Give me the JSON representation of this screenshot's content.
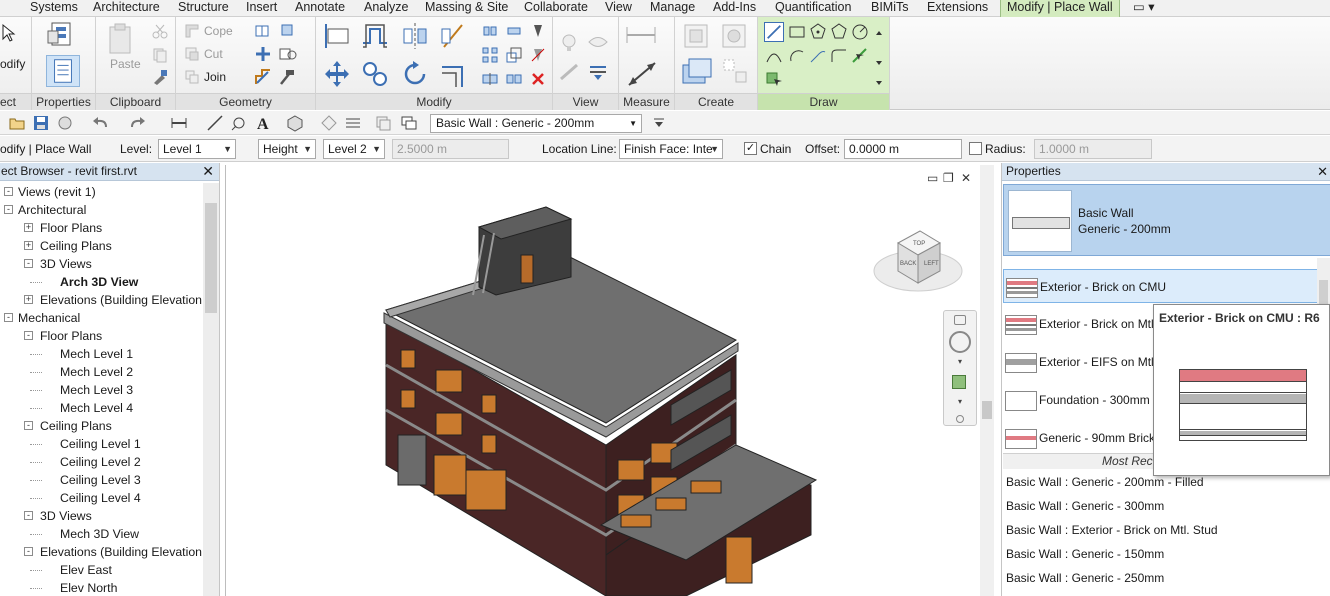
{
  "ribbon_tabs": [
    "Systems",
    "Architecture",
    "Structure",
    "Insert",
    "Annotate",
    "Analyze",
    "Massing & Site",
    "Collaborate",
    "View",
    "Manage",
    "Add-Ins",
    "Quantification",
    "BIMiTs",
    "Extensions",
    "Modify | Place Wall"
  ],
  "active_tab": "Modify | Place Wall",
  "ribbon": {
    "select_label": "ect",
    "modify_label": "odify",
    "panels": {
      "properties": "Properties",
      "clipboard": "Clipboard",
      "geometry": "Geometry",
      "modify": "Modify",
      "view": "View",
      "measure": "Measure",
      "create": "Create",
      "draw": "Draw"
    },
    "clipboard": {
      "paste": "Paste"
    },
    "geometry": {
      "cope": "Cope",
      "cut": "Cut",
      "join": "Join"
    }
  },
  "qat": {
    "type_selector": "Basic Wall : Generic - 200mm"
  },
  "options_bar": {
    "context": "odify | Place Wall",
    "level_label": "Level:",
    "level_value": "Level 1",
    "height_mode": "Height",
    "height_target": "Level 2",
    "height_value": "2.5000 m",
    "location_line_label": "Location Line:",
    "location_line_value": "Finish Face: Inte",
    "chain_label": "Chain",
    "chain_checked": true,
    "offset_label": "Offset:",
    "offset_value": "0.0000 m",
    "radius_label": "Radius:",
    "radius_checked": false,
    "radius_value": "1.0000 m"
  },
  "project_browser": {
    "title": "ect Browser - revit first.rvt",
    "tree": [
      {
        "label": "Views (revit 1)",
        "level": 0,
        "toggle": "-"
      },
      {
        "label": "Architectural",
        "level": 0,
        "toggle": "-"
      },
      {
        "label": "Floor Plans",
        "level": 1,
        "toggle": "+"
      },
      {
        "label": "Ceiling Plans",
        "level": 1,
        "toggle": "+"
      },
      {
        "label": "3D Views",
        "level": 1,
        "toggle": "-"
      },
      {
        "label": "Arch 3D View",
        "level": 2,
        "toggle": "",
        "bold": true
      },
      {
        "label": "Elevations (Building Elevation",
        "level": 1,
        "toggle": "+"
      },
      {
        "label": "Mechanical",
        "level": 0,
        "toggle": "-"
      },
      {
        "label": "Floor Plans",
        "level": 1,
        "toggle": "-"
      },
      {
        "label": "Mech Level 1",
        "level": 2,
        "toggle": ""
      },
      {
        "label": "Mech Level 2",
        "level": 2,
        "toggle": ""
      },
      {
        "label": "Mech Level 3",
        "level": 2,
        "toggle": ""
      },
      {
        "label": "Mech Level 4",
        "level": 2,
        "toggle": ""
      },
      {
        "label": "Ceiling Plans",
        "level": 1,
        "toggle": "-"
      },
      {
        "label": "Ceiling Level 1",
        "level": 2,
        "toggle": ""
      },
      {
        "label": "Ceiling Level 2",
        "level": 2,
        "toggle": ""
      },
      {
        "label": "Ceiling Level 3",
        "level": 2,
        "toggle": ""
      },
      {
        "label": "Ceiling Level 4",
        "level": 2,
        "toggle": ""
      },
      {
        "label": "3D Views",
        "level": 1,
        "toggle": "-"
      },
      {
        "label": "Mech 3D View",
        "level": 2,
        "toggle": ""
      },
      {
        "label": "Elevations (Building Elevation",
        "level": 1,
        "toggle": "-"
      },
      {
        "label": "Elev East",
        "level": 2,
        "toggle": ""
      },
      {
        "label": "Elev North",
        "level": 2,
        "toggle": ""
      }
    ]
  },
  "viewcube": {
    "top_face": "TOP",
    "back_face": "BACK",
    "left_face": "LEFT"
  },
  "properties": {
    "title": "Properties",
    "family": "Basic Wall",
    "type": "Generic - 200mm",
    "type_list": [
      {
        "label": "Exterior - Brick on CMU",
        "selected": true,
        "swatch": "brick"
      },
      {
        "label": "Exterior - Brick on Mtl",
        "selected": false,
        "swatch": "brick"
      },
      {
        "label": "Exterior - EIFS on Mtl",
        "selected": false,
        "swatch": "eifs"
      },
      {
        "label": "Foundation - 300mm",
        "selected": false,
        "swatch": "plain"
      },
      {
        "label": "Generic - 90mm Brick",
        "selected": false,
        "swatch": "thinbrick"
      }
    ],
    "recent_header": "Most Rece",
    "recent": [
      "Basic Wall : Generic - 200mm - Filled",
      "Basic Wall : Generic - 300mm",
      "Basic Wall : Exterior - Brick on Mtl. Stud",
      "Basic Wall : Generic - 150mm",
      "Basic Wall : Generic - 250mm"
    ],
    "tooltip_title": "Exterior - Brick on CMU : R6"
  },
  "colors": {
    "active_tab_bg": "#d4ebbf",
    "draw_panel_bg": "#d9efc6",
    "panel_header_bg": "#d6e3f0",
    "selection_bg": "#b8d3ee",
    "brick_color": "#e07a82"
  }
}
